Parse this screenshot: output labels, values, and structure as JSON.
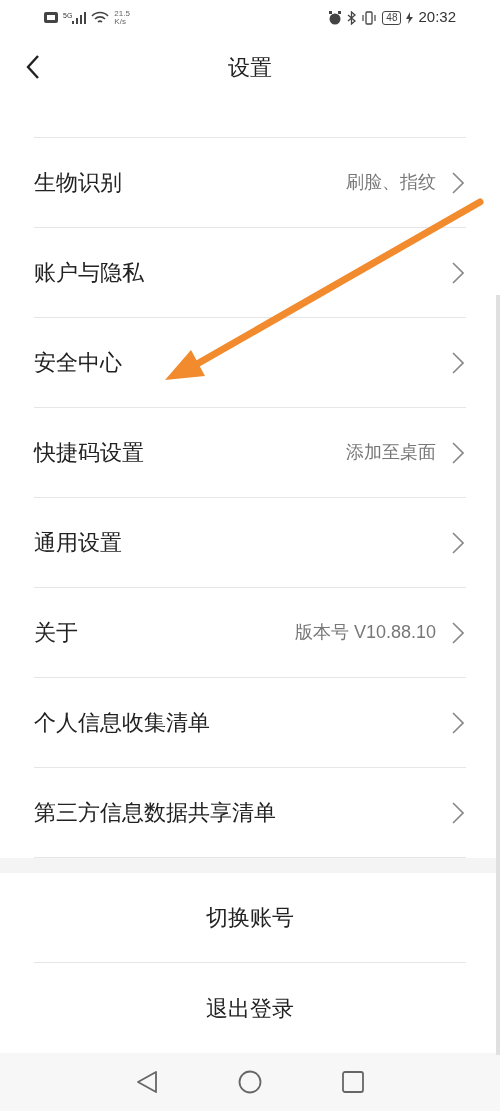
{
  "status_bar": {
    "network": "5G",
    "speed_value": "21.5",
    "speed_unit": "K/s",
    "battery": "48",
    "time": "20:32"
  },
  "header": {
    "title": "设置"
  },
  "settings": [
    {
      "label": "生物识别",
      "value": "刷脸、指纹"
    },
    {
      "label": "账户与隐私"
    },
    {
      "label": "安全中心"
    },
    {
      "label": "快捷码设置",
      "value": "添加至桌面"
    },
    {
      "label": "通用设置"
    },
    {
      "label": "关于",
      "value": "版本号 V10.88.10"
    },
    {
      "label": "个人信息收集清单"
    },
    {
      "label": "第三方信息数据共享清单"
    }
  ],
  "actions": [
    "切换账号",
    "退出登录"
  ]
}
